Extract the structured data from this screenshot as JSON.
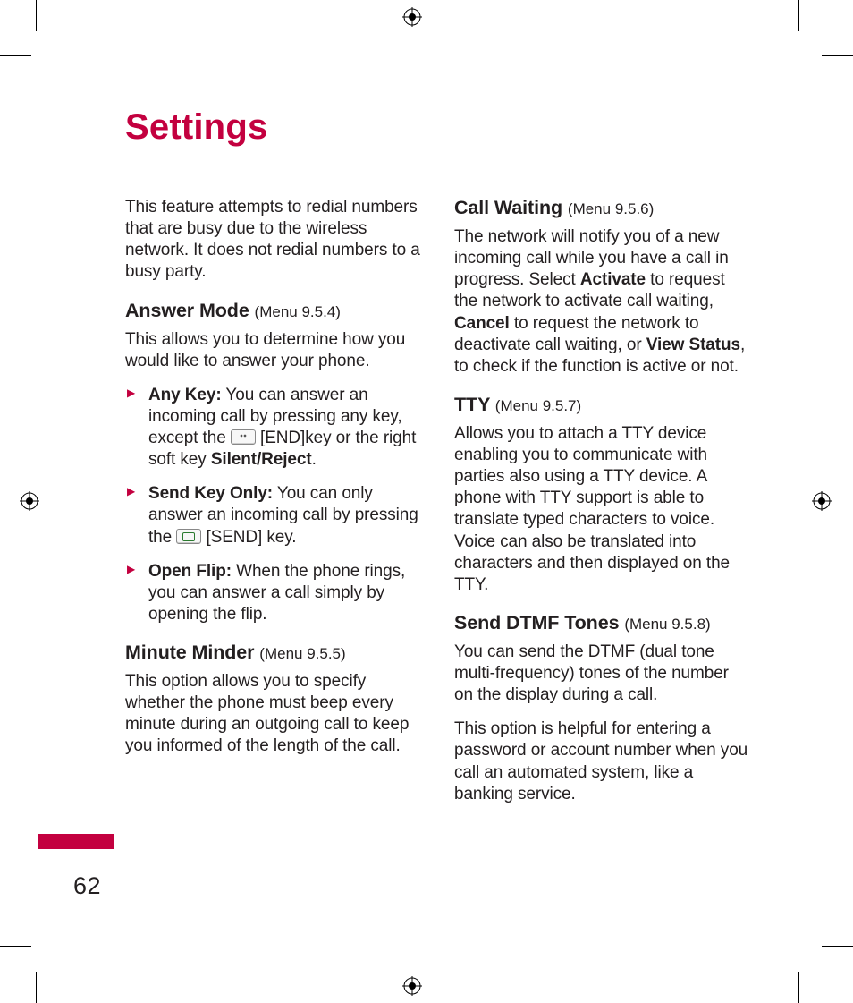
{
  "title": "Settings",
  "page_number": "62",
  "intro": "This feature attempts to redial numbers that are busy due to the wireless network. It does not redial numbers to a busy party.",
  "sections": {
    "answer_mode": {
      "heading": "Answer Mode",
      "menu": "(Menu 9.5.4)",
      "lead": "This allows you to determine how you would like to answer your phone.",
      "items": {
        "any_key": {
          "label": "Any Key:",
          "before_icon": " You can answer an incoming call by pressing any key, except the ",
          "after_icon": " [END]key or the right soft key ",
          "bold_tail": "Silent/Reject",
          "tail": "."
        },
        "send_key": {
          "label": "Send Key Only:",
          "before_icon": " You can only answer an incoming call by pressing the ",
          "after_icon": " [SEND] key."
        },
        "open_flip": {
          "label": "Open Flip:",
          "text": " When the phone rings, you can answer a call simply by opening the flip."
        }
      }
    },
    "minute_minder": {
      "heading": "Minute Minder",
      "menu": "(Menu 9.5.5)",
      "body": "This option allows you to specify whether the phone must beep every minute during an outgoing call to keep you informed of the length of the call."
    },
    "call_waiting": {
      "heading": "Call Waiting",
      "menu": "(Menu 9.5.6)",
      "body_a": "The network will notify you of a new incoming call while you have a call in progress. Select ",
      "bold1": "Activate",
      "body_b": " to request the network to activate call waiting, ",
      "bold2": "Cancel",
      "body_c": " to request the network to deactivate call waiting, or ",
      "bold3": "View Status",
      "body_d": ", to check if the function is active or not."
    },
    "tty": {
      "heading": "TTY",
      "menu": "(Menu 9.5.7)",
      "body": "Allows you to attach a TTY device enabling you to communicate with parties also using a TTY device. A phone with TTY support is able to translate typed characters to voice. Voice can also be translated into characters and then displayed on the TTY."
    },
    "dtmf": {
      "heading": "Send DTMF Tones",
      "menu": "(Menu 9.5.8)",
      "body1": "You can send the DTMF (dual tone multi-frequency) tones of the number on the display during a call.",
      "body2": "This option is helpful for entering a password or account number when you call an automated system, like a banking service."
    }
  }
}
